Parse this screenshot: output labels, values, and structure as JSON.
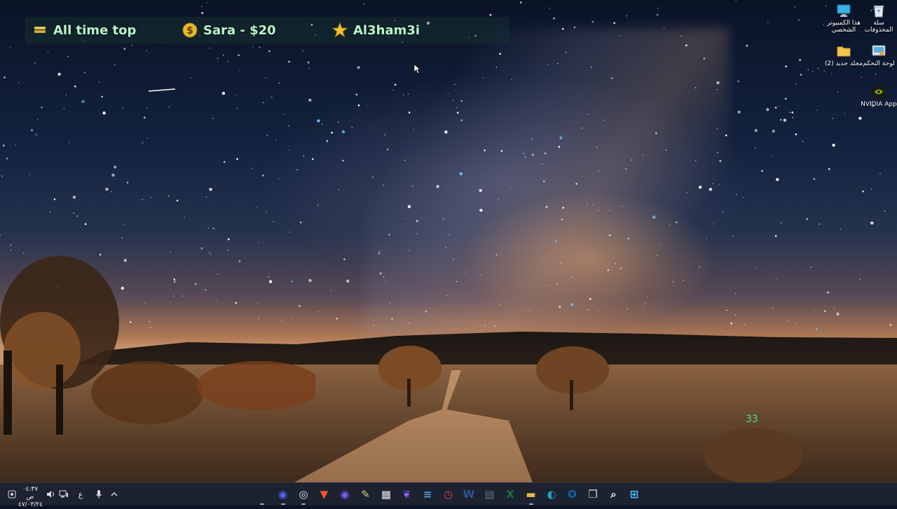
{
  "ticker": {
    "items": [
      {
        "icon": "gold-bar-icon",
        "text": "All time top"
      },
      {
        "icon": "dollar-coin-icon",
        "text": "Sara - $20"
      },
      {
        "icon": "star-icon",
        "text": "Al3ham3i"
      }
    ]
  },
  "desktop_icons": [
    {
      "name": "recycle-bin",
      "icon": "recycle-bin-icon",
      "label": "سلة المحذوفات"
    },
    {
      "name": "this-pc",
      "icon": "monitor-icon",
      "label": "هذا الكمبيوتر الشخصي"
    },
    {
      "name": "control-panel",
      "icon": "control-panel-icon",
      "label": "لوحة التحكم"
    },
    {
      "name": "new-folder",
      "icon": "folder-icon",
      "label": "مجلد جديد (2)"
    },
    {
      "name": "nvidia-app",
      "icon": "nvidia-icon",
      "label": "NVIDIA App"
    }
  ],
  "overlay_counter": "33",
  "taskbar": {
    "clock_time": "٠٤:٣٧ ص",
    "clock_date": "٤٧/٠٣/٢٤",
    "language": "ع",
    "tray_icons": [
      "widgets-icon",
      "volume-icon",
      "network-icon",
      "microphone-icon",
      "chevron-up-icon"
    ],
    "apps": [
      {
        "name": "steam",
        "icon": "steam-icon",
        "color": "#1b2838",
        "glyph": "♨"
      },
      {
        "name": "discord",
        "icon": "discord-icon",
        "color": "#5865f2",
        "glyph": "◉"
      },
      {
        "name": "chrome",
        "icon": "chrome-icon",
        "color": "#e8e8e8",
        "glyph": "◎"
      },
      {
        "name": "brave",
        "icon": "brave-icon",
        "color": "#fb542b",
        "glyph": "▼"
      },
      {
        "name": "discord-ptb",
        "icon": "discord-alt-icon",
        "color": "#7a5cff",
        "glyph": "◉"
      },
      {
        "name": "notes",
        "icon": "sticky-notes-icon",
        "color": "#c9d36a",
        "glyph": "✎"
      },
      {
        "name": "store",
        "icon": "store-icon",
        "color": "#eaeaea",
        "glyph": "▦"
      },
      {
        "name": "feather",
        "icon": "feather-icon",
        "color": "#8b5cf6",
        "glyph": "❦"
      },
      {
        "name": "notepad",
        "icon": "notepad-icon",
        "color": "#4aa3df",
        "glyph": "≡"
      },
      {
        "name": "clock-app",
        "icon": "clock-icon",
        "color": "#d04040",
        "glyph": "◷"
      },
      {
        "name": "word",
        "icon": "word-icon",
        "color": "#2b579a",
        "glyph": "W"
      },
      {
        "name": "calculator",
        "icon": "calculator-icon",
        "color": "#607080",
        "glyph": "▤"
      },
      {
        "name": "excel",
        "icon": "excel-icon",
        "color": "#1d6f42",
        "glyph": "X"
      },
      {
        "name": "file-explorer",
        "icon": "folder-icon",
        "color": "#e8b84a",
        "glyph": "▬"
      },
      {
        "name": "edge",
        "icon": "edge-icon",
        "color": "#1fa0c8",
        "glyph": "◐"
      },
      {
        "name": "outlook",
        "icon": "outlook-icon",
        "color": "#0a64b4",
        "glyph": "O"
      },
      {
        "name": "task-view",
        "icon": "task-view-icon",
        "color": "#cfd6e0",
        "glyph": "❐"
      },
      {
        "name": "search",
        "icon": "search-icon",
        "color": "#ffffff",
        "glyph": "⌕"
      },
      {
        "name": "start",
        "icon": "windows-start-icon",
        "color": "#4cc2ff",
        "glyph": "⊞"
      }
    ]
  }
}
